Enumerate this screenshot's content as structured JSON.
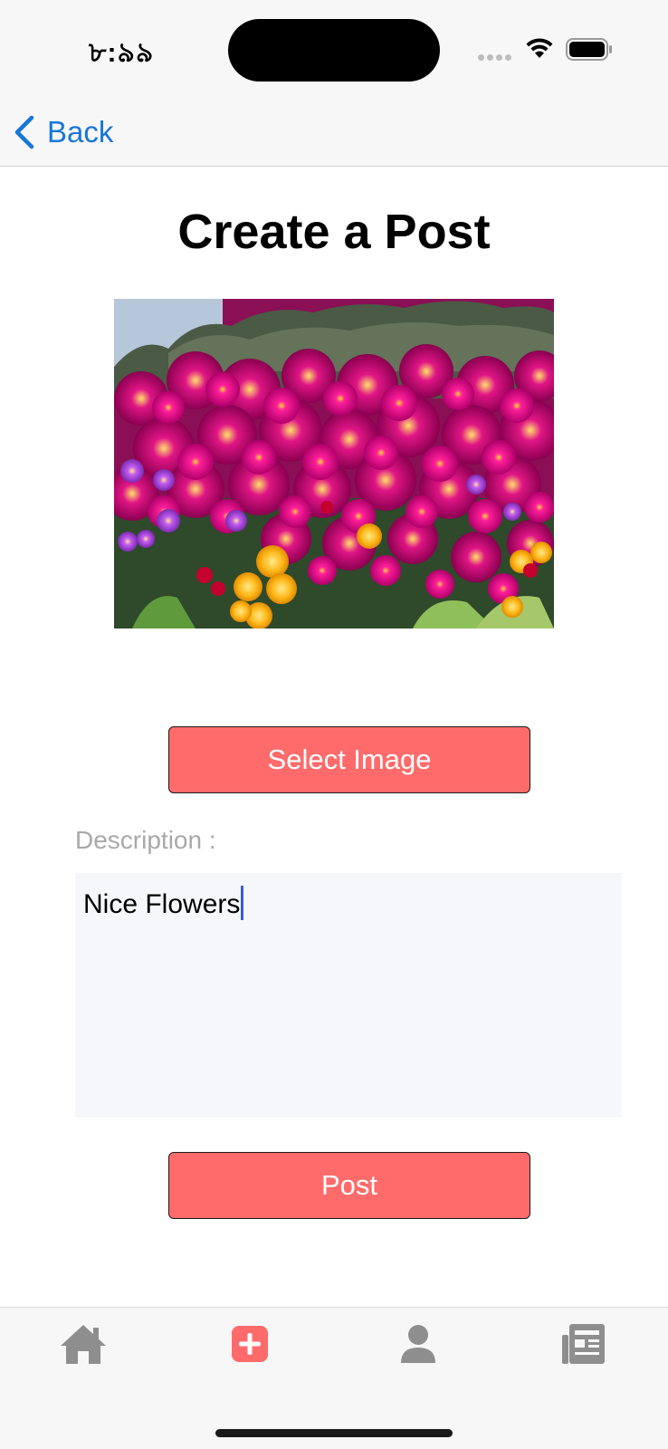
{
  "status_bar": {
    "time": "৮:৯৯"
  },
  "nav": {
    "back_label": "Back"
  },
  "page": {
    "title": "Create a Post"
  },
  "buttons": {
    "select_image": "Select Image",
    "post": "Post"
  },
  "description": {
    "label": "Description :",
    "value": "Nice Flowers"
  },
  "tab_bar": {
    "items": [
      {
        "icon": "home-icon",
        "selected": false
      },
      {
        "icon": "add-post-icon",
        "selected": true
      },
      {
        "icon": "profile-icon",
        "selected": false
      },
      {
        "icon": "news-icon",
        "selected": false
      }
    ]
  },
  "colors": {
    "accent": "#ff6b6b",
    "link": "#1877d8",
    "tab_inactive": "#8e8e8e"
  }
}
